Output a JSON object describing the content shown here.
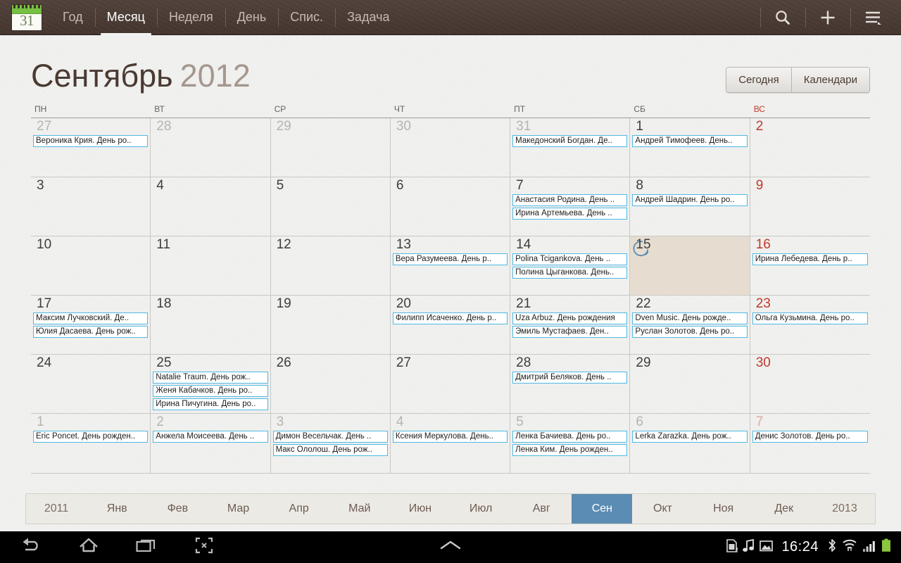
{
  "toolbar": {
    "app_icon": {
      "name": "calendar-icon",
      "day": "31"
    },
    "tabs": [
      {
        "label": "Год",
        "active": false
      },
      {
        "label": "Месяц",
        "active": true
      },
      {
        "label": "Неделя",
        "active": false
      },
      {
        "label": "День",
        "active": false
      },
      {
        "label": "Спис.",
        "active": false
      },
      {
        "label": "Задача",
        "active": false
      }
    ],
    "actions": [
      {
        "name": "search-icon",
        "label": "Поиск"
      },
      {
        "name": "add-icon",
        "label": "Добавить"
      },
      {
        "name": "menu-icon",
        "label": "Меню"
      }
    ]
  },
  "header": {
    "month": "Сентябрь",
    "year": "2012",
    "today_button": "Сегодня",
    "calendars_button": "Календари"
  },
  "weekdays": [
    {
      "label": "ПН",
      "sunday": false
    },
    {
      "label": "ВТ",
      "sunday": false
    },
    {
      "label": "СР",
      "sunday": false
    },
    {
      "label": "ЧТ",
      "sunday": false
    },
    {
      "label": "ПТ",
      "sunday": false
    },
    {
      "label": "СБ",
      "sunday": false
    },
    {
      "label": "ВС",
      "sunday": true
    }
  ],
  "weeks": [
    [
      {
        "day": "27",
        "other": true,
        "today": false,
        "events": [
          "Вероника Крия. День ро.."
        ]
      },
      {
        "day": "28",
        "other": true,
        "today": false,
        "events": []
      },
      {
        "day": "29",
        "other": true,
        "today": false,
        "events": []
      },
      {
        "day": "30",
        "other": true,
        "today": false,
        "events": []
      },
      {
        "day": "31",
        "other": true,
        "today": false,
        "events": [
          "Македонский Богдан. Де.."
        ]
      },
      {
        "day": "1",
        "other": false,
        "today": false,
        "events": [
          "Андрей Тимофеев. День.."
        ]
      },
      {
        "day": "2",
        "other": false,
        "today": false,
        "sunday": true,
        "events": []
      }
    ],
    [
      {
        "day": "3",
        "other": false,
        "today": false,
        "events": []
      },
      {
        "day": "4",
        "other": false,
        "today": false,
        "events": []
      },
      {
        "day": "5",
        "other": false,
        "today": false,
        "events": []
      },
      {
        "day": "6",
        "other": false,
        "today": false,
        "events": []
      },
      {
        "day": "7",
        "other": false,
        "today": false,
        "events": [
          "Анастасия Родина. День ..",
          "Ирина Артемьева. День .."
        ]
      },
      {
        "day": "8",
        "other": false,
        "today": false,
        "events": [
          "Андрей Шадрин. День ро.."
        ]
      },
      {
        "day": "9",
        "other": false,
        "today": false,
        "sunday": true,
        "events": []
      }
    ],
    [
      {
        "day": "10",
        "other": false,
        "today": false,
        "events": []
      },
      {
        "day": "11",
        "other": false,
        "today": false,
        "events": []
      },
      {
        "day": "12",
        "other": false,
        "today": false,
        "events": []
      },
      {
        "day": "13",
        "other": false,
        "today": false,
        "events": [
          "Вера Разумеева. День р.."
        ]
      },
      {
        "day": "14",
        "other": false,
        "today": false,
        "events": [
          "Polina Tcigankova. День ..",
          "Полина Цыганкова. День.."
        ]
      },
      {
        "day": "15",
        "other": false,
        "today": true,
        "events": []
      },
      {
        "day": "16",
        "other": false,
        "today": false,
        "sunday": true,
        "events": [
          "Ирина Лебедева. День р.."
        ]
      }
    ],
    [
      {
        "day": "17",
        "other": false,
        "today": false,
        "events": [
          "Максим Лучковский. Де..",
          "Юлия Дасаева. День рож.."
        ]
      },
      {
        "day": "18",
        "other": false,
        "today": false,
        "events": []
      },
      {
        "day": "19",
        "other": false,
        "today": false,
        "events": []
      },
      {
        "day": "20",
        "other": false,
        "today": false,
        "events": [
          "Филипп Исаченко. День р.."
        ]
      },
      {
        "day": "21",
        "other": false,
        "today": false,
        "events": [
          "Uza Arbuz. День рождения",
          "Эмиль Мустафаев. Ден.."
        ]
      },
      {
        "day": "22",
        "other": false,
        "today": false,
        "events": [
          "Dven Music. День рожде..",
          "Руслан Золотов. День ро.."
        ]
      },
      {
        "day": "23",
        "other": false,
        "today": false,
        "sunday": true,
        "events": [
          "Ольга Кузьмина. День ро.."
        ]
      }
    ],
    [
      {
        "day": "24",
        "other": false,
        "today": false,
        "events": []
      },
      {
        "day": "25",
        "other": false,
        "today": false,
        "events": [
          "Natalie Traum. День рож..",
          "Женя Кабачков. День ро..",
          "Ирина Пичугина. День ро.."
        ]
      },
      {
        "day": "26",
        "other": false,
        "today": false,
        "events": []
      },
      {
        "day": "27",
        "other": false,
        "today": false,
        "events": []
      },
      {
        "day": "28",
        "other": false,
        "today": false,
        "events": [
          "Дмитрий Беляков. День .."
        ]
      },
      {
        "day": "29",
        "other": false,
        "today": false,
        "events": []
      },
      {
        "day": "30",
        "other": false,
        "today": false,
        "sunday": true,
        "events": []
      }
    ],
    [
      {
        "day": "1",
        "other": true,
        "today": false,
        "events": [
          "Eric Poncet. День рожден.."
        ]
      },
      {
        "day": "2",
        "other": true,
        "today": false,
        "events": [
          "Анжела Моисеева. День .."
        ]
      },
      {
        "day": "3",
        "other": true,
        "today": false,
        "events": [
          "Димон Весельчак. День ..",
          "Макс Ололош. День рож.."
        ]
      },
      {
        "day": "4",
        "other": true,
        "today": false,
        "events": [
          "Ксения Меркулова. День.."
        ]
      },
      {
        "day": "5",
        "other": true,
        "today": false,
        "events": [
          "Ленка Бачиева. День ро..",
          "Ленка Ким. День рожден.."
        ]
      },
      {
        "day": "6",
        "other": true,
        "today": false,
        "events": [
          "Lerka Zarazka. День рож.."
        ]
      },
      {
        "day": "7",
        "other": true,
        "today": false,
        "sunday": true,
        "events": [
          "Денис Золотов. День ро.."
        ]
      }
    ]
  ],
  "month_strip": [
    {
      "label": "2011",
      "type": "year",
      "selected": false
    },
    {
      "label": "Янв",
      "type": "month",
      "selected": false
    },
    {
      "label": "Фев",
      "type": "month",
      "selected": false
    },
    {
      "label": "Мар",
      "type": "month",
      "selected": false
    },
    {
      "label": "Апр",
      "type": "month",
      "selected": false
    },
    {
      "label": "Май",
      "type": "month",
      "selected": false
    },
    {
      "label": "Июн",
      "type": "month",
      "selected": false
    },
    {
      "label": "Июл",
      "type": "month",
      "selected": false
    },
    {
      "label": "Авг",
      "type": "month",
      "selected": false
    },
    {
      "label": "Сен",
      "type": "month",
      "selected": true
    },
    {
      "label": "Окт",
      "type": "month",
      "selected": false
    },
    {
      "label": "Ноя",
      "type": "month",
      "selected": false
    },
    {
      "label": "Дек",
      "type": "month",
      "selected": false
    },
    {
      "label": "2013",
      "type": "year",
      "selected": false
    }
  ],
  "navbar": {
    "buttons": [
      {
        "name": "back-icon"
      },
      {
        "name": "home-icon"
      },
      {
        "name": "recents-icon"
      },
      {
        "name": "screenshot-icon"
      }
    ],
    "center": {
      "name": "chevron-up-icon"
    },
    "status": {
      "icons": [
        "sd-card-icon",
        "music-note-icon",
        "image-icon"
      ],
      "clock": "16:24",
      "trailing_icons": [
        "bluetooth-icon",
        "wifi-icon",
        "signal-icon",
        "battery-icon"
      ]
    }
  },
  "colors": {
    "toolbar_bg": "#4b3a33",
    "event_border": "#4fb9e3",
    "today_bg": "#e6ddd0",
    "selected_month": "#5b8cb3",
    "sunday_text": "#c0392b",
    "title_month": "#4a3a32",
    "title_year": "#a4978e"
  }
}
